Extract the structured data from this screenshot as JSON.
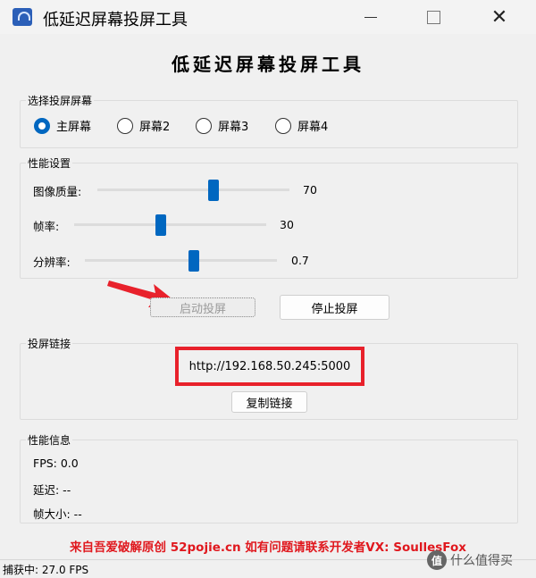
{
  "window": {
    "title": "低延迟屏幕投屏工具"
  },
  "header": {
    "title": "低延迟屏幕投屏工具"
  },
  "screen_group": {
    "label": "选择投屏屏幕",
    "options": [
      {
        "label": "主屏幕",
        "selected": true
      },
      {
        "label": "屏幕2",
        "selected": false
      },
      {
        "label": "屏幕3",
        "selected": false
      },
      {
        "label": "屏幕4",
        "selected": false
      }
    ]
  },
  "perf_group": {
    "label": "性能设置",
    "sliders": [
      {
        "label": "图像质量:",
        "value": "70"
      },
      {
        "label": "帧率:",
        "value": "30"
      },
      {
        "label": "分辨率:",
        "value": "0.7"
      }
    ]
  },
  "buttons": {
    "start": "启动投屏",
    "stop": "停止投屏",
    "copy": "复制链接"
  },
  "link_group": {
    "label": "投屏链接",
    "url": "http://192.168.50.245:5000"
  },
  "info_group": {
    "label": "性能信息",
    "fps": "FPS: 0.0",
    "latency": "延迟: --",
    "frame_size": "帧大小: --"
  },
  "notice": "来自吾爱破解原创 52pojie.cn 如有问题请联系开发者VX: SoullesFox",
  "status": "捕获中: 27.0 FPS",
  "watermark": {
    "badge": "值",
    "text": "什么值得买"
  },
  "colors": {
    "accent": "#0067c0",
    "highlight": "#e8212b",
    "notice": "#e0181e"
  }
}
